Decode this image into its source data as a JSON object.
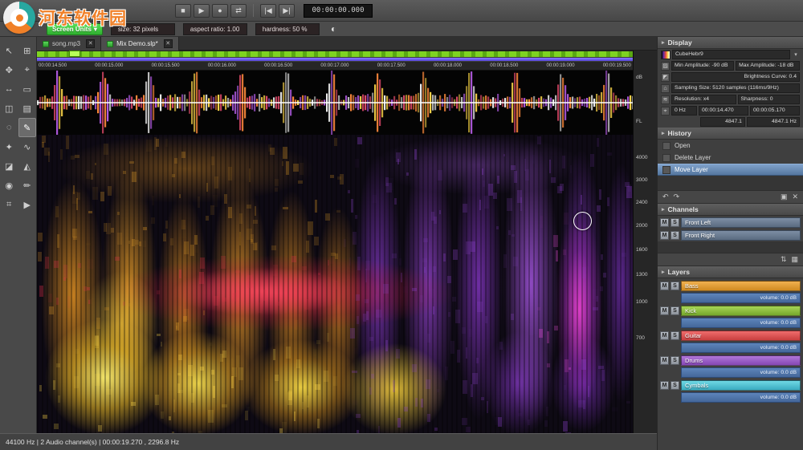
{
  "colors": {
    "selection_blue": "#55779f",
    "overview_green": "#7ed321",
    "overview_purple": "#6a5ae8",
    "units_button_green": "#3ecf3e",
    "layer_bass": "#e09a32",
    "layer_kick": "#8fc43f",
    "layer_guitar": "#e05555",
    "layer_drums": "#9c5fc8",
    "layer_cymbals": "#52c8d8"
  },
  "icons": {
    "caret_down": "▾",
    "section_arrow": "▸",
    "contrast": "◐",
    "close": "✕",
    "display_rows": [
      "▨",
      "◩",
      "⌂",
      "≋",
      "⌖"
    ]
  },
  "watermark": {
    "site_name": "河东软件园"
  },
  "transport": {
    "time": "00:00:00.000",
    "buttons": [
      {
        "name": "stop",
        "glyph": "■"
      },
      {
        "name": "play",
        "glyph": "▶"
      },
      {
        "name": "record",
        "glyph": "●"
      },
      {
        "name": "loop",
        "glyph": "⇄"
      },
      {
        "name": "skip-start",
        "glyph": "|◀"
      },
      {
        "name": "skip-end",
        "glyph": "▶|"
      }
    ]
  },
  "brush_bar": {
    "units": "Screen Units",
    "size": "size: 32 pixels",
    "aspect": "aspect ratio: 1.00",
    "hardness": "hardness: 50 %"
  },
  "tabs": [
    {
      "label": "song.mp3"
    },
    {
      "label": "Mix Demo.slp*"
    }
  ],
  "timeline": {
    "labels": [
      "00:00:14.500",
      "00:00:15.000",
      "00:00:15.500",
      "00:00:16.000",
      "00:00:16.500",
      "00:00:17.000",
      "00:00:17.500",
      "00:00:18.000",
      "00:00:18.500",
      "00:00:19.000",
      "00:00:19.500"
    ]
  },
  "wave_ruler": {
    "db": "dB",
    "fl": "FL"
  },
  "freq_ruler": {
    "labels": [
      "4000",
      "3000",
      "2400",
      "2000",
      "1600",
      "1300",
      "1000",
      "700"
    ]
  },
  "tools": [
    {
      "name": "select",
      "glyph": "↖"
    },
    {
      "name": "transform",
      "glyph": "⊞"
    },
    {
      "name": "hand",
      "glyph": "✥"
    },
    {
      "name": "zoom",
      "glyph": "⌖"
    },
    {
      "name": "scroll",
      "glyph": "↔"
    },
    {
      "name": "marquee",
      "glyph": "▭"
    },
    {
      "name": "time-select",
      "glyph": "◫"
    },
    {
      "name": "freq-select",
      "glyph": "▤"
    },
    {
      "name": "lasso",
      "glyph": "◌"
    },
    {
      "name": "brush",
      "glyph": "✎"
    },
    {
      "name": "wand",
      "glyph": "✦"
    },
    {
      "name": "harmonics",
      "glyph": "∿"
    },
    {
      "name": "eraser",
      "glyph": "◪"
    },
    {
      "name": "amplify",
      "glyph": "◭"
    },
    {
      "name": "clone",
      "glyph": "◉"
    },
    {
      "name": "pencil",
      "glyph": "✏"
    },
    {
      "name": "measure",
      "glyph": "⌗"
    },
    {
      "name": "play-tool",
      "glyph": "▶"
    }
  ],
  "display_panel": {
    "title": "Display",
    "colormap": "CubeHebr9",
    "min_amp": "Min Amplitude: -90 dB",
    "max_amp": "Max Amplitude: -18 dB",
    "brightness": "Brightness Curve: 0.4",
    "sampling": "Sampling Size: 5120 samples (116ms/9Hz)",
    "resolution": "Resolution: x4",
    "sharpness": "Sharpness: 0",
    "freq_field": "0 Hz",
    "time_start": "00:00:14.470",
    "time_length": "00:00:05.170",
    "freq_value_1": "4847.1",
    "freq_value_2": "4847.1 Hz"
  },
  "history_panel": {
    "title": "History",
    "items": [
      {
        "label": "Open",
        "selected": false
      },
      {
        "label": "Delete Layer",
        "selected": false
      },
      {
        "label": "Move Layer",
        "selected": true
      }
    ],
    "toolbar": [
      {
        "name": "undo",
        "glyph": "↶"
      },
      {
        "name": "redo",
        "glyph": "↷"
      },
      {
        "name": "copy",
        "glyph": "▣"
      },
      {
        "name": "delete",
        "glyph": "✕"
      }
    ]
  },
  "channels_panel": {
    "title": "Channels",
    "mute_label": "M",
    "solo_label": "S",
    "items": [
      {
        "name": "Front Left"
      },
      {
        "name": "Front Right"
      }
    ],
    "toolbar": [
      {
        "name": "reorder",
        "glyph": "⇅"
      },
      {
        "name": "grid",
        "glyph": "▦"
      }
    ]
  },
  "layers_panel": {
    "title": "Layers",
    "mute_label": "M",
    "solo_label": "S",
    "volume_label": "volume: 0.0 dB",
    "items": [
      {
        "name": "Bass",
        "color": "#e09a32"
      },
      {
        "name": "Kick",
        "color": "#8fc43f"
      },
      {
        "name": "Guitar",
        "color": "#e05555"
      },
      {
        "name": "Drums",
        "color": "#9c5fc8"
      },
      {
        "name": "Cymbals",
        "color": "#52c8d8"
      }
    ]
  },
  "status_bar": {
    "text": "44100 Hz | 2 Audio channel(s) | 00:00:19.270 , 2296.8 Hz"
  }
}
